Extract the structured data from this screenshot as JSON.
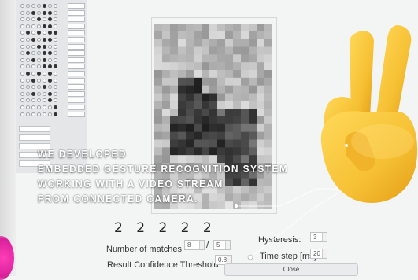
{
  "overlay_lines": [
    "WE DEVELOPED",
    "EMBEDDED GESTURE RECOGNITION SYSTEM",
    "WORKING WITH A VIDEO STREAM",
    "FROM CONNECTED CAMERA."
  ],
  "recognized_digits": "2 2 2 2 2",
  "settings": {
    "matches_label": "Number of matches",
    "matches_value": "8",
    "matches_separator": "/",
    "matches_total": "5",
    "confidence_label": "Result Confidence Threshold:",
    "confidence_value": "0.8",
    "hysteresis_label": "Hysteresis:",
    "hysteresis_value": "3",
    "timestep_label": "Time step [ms]",
    "timestep_value": "20",
    "close_label": "Close"
  },
  "icons": {
    "victory_hand": "victory-hand-emoji",
    "camera_preview": "pixelated-hand-preview"
  },
  "colors": {
    "background": "#f3f4f4",
    "overlay_text": "#ffffff",
    "emoji_yellow": "#f6c033",
    "accent_pink": "#e02aa6"
  }
}
